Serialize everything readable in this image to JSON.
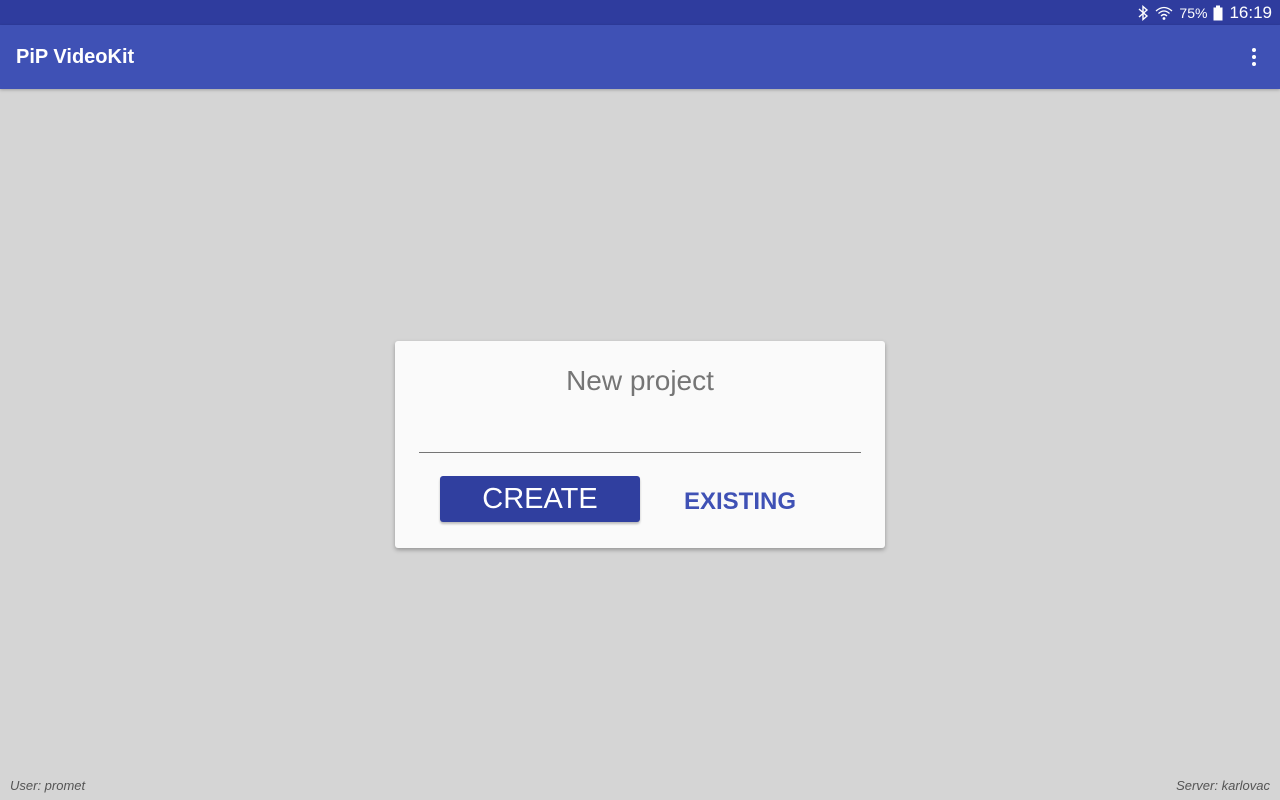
{
  "status_bar": {
    "battery_percent": "75%",
    "time": "16:19",
    "icons": [
      "bluetooth-icon",
      "wifi-icon",
      "battery-icon"
    ]
  },
  "app_bar": {
    "title": "PiP VideoKit",
    "menu_icon": "more-vert-icon"
  },
  "dialog": {
    "title": "New project",
    "input_value": "",
    "create_label": "CREATE",
    "existing_label": "EXISTING"
  },
  "footer": {
    "user": "User: promet",
    "server": "Server: karlovac"
  },
  "colors": {
    "status_bar": "#2f3c9e",
    "app_bar": "#3f51b5",
    "primary_button": "#303f9f",
    "accent_text": "#3f51b5",
    "background": "#d5d5d5"
  }
}
